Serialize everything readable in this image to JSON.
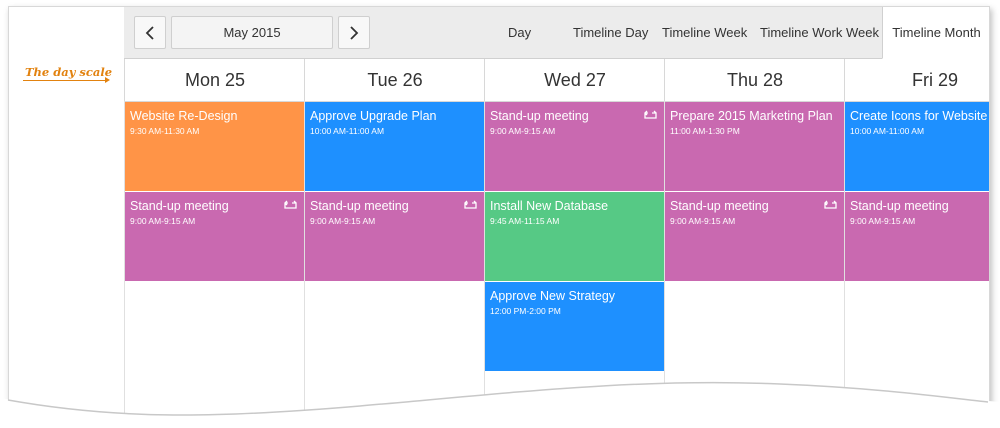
{
  "annotation": "The day scale",
  "toolbar": {
    "prev_icon": "chevron-left-icon",
    "next_icon": "chevron-right-icon",
    "date_label": "May 2015",
    "views": [
      {
        "label": "Day"
      },
      {
        "label": "Timeline Day"
      },
      {
        "label": "Timeline Week"
      },
      {
        "label": "Timeline Work Week"
      },
      {
        "label": "Timeline Month",
        "active": true
      }
    ]
  },
  "days": [
    {
      "label": "Mon 25"
    },
    {
      "label": "Tue 26"
    },
    {
      "label": "Wed 27"
    },
    {
      "label": "Thu 28"
    },
    {
      "label": "Fri 29"
    }
  ],
  "colors": {
    "orange": "#ff9447",
    "blue": "#1e90ff",
    "purple": "#c969b0",
    "green": "#56c985",
    "accent": "#e2820f"
  },
  "appointments": [
    {
      "day": 0,
      "row": 0,
      "subject": "Website Re-Design",
      "time": "9:30 AM-11:30 AM",
      "color": "orange",
      "recurring": false
    },
    {
      "day": 0,
      "row": 1,
      "subject": "Stand-up meeting",
      "time": "9:00 AM-9:15 AM",
      "color": "purple",
      "recurring": true
    },
    {
      "day": 1,
      "row": 0,
      "subject": "Approve Upgrade Plan",
      "time": "10:00 AM-11:00 AM",
      "color": "blue",
      "recurring": false
    },
    {
      "day": 1,
      "row": 1,
      "subject": "Stand-up meeting",
      "time": "9:00 AM-9:15 AM",
      "color": "purple",
      "recurring": true
    },
    {
      "day": 2,
      "row": 0,
      "subject": "Stand-up meeting",
      "time": "9:00 AM-9:15 AM",
      "color": "purple",
      "recurring": true
    },
    {
      "day": 2,
      "row": 1,
      "subject": "Install New Database",
      "time": "9:45 AM-11:15 AM",
      "color": "green",
      "recurring": false
    },
    {
      "day": 2,
      "row": 2,
      "subject": "Approve New Strategy",
      "time": "12:00 PM-2:00 PM",
      "color": "blue",
      "recurring": false
    },
    {
      "day": 3,
      "row": 0,
      "subject": "Prepare 2015 Marketing Plan",
      "time": "11:00 AM-1:30 PM",
      "color": "purple",
      "recurring": false
    },
    {
      "day": 3,
      "row": 1,
      "subject": "Stand-up meeting",
      "time": "9:00 AM-9:15 AM",
      "color": "purple",
      "recurring": true
    },
    {
      "day": 4,
      "row": 0,
      "subject": "Create Icons for Website",
      "time": "10:00 AM-11:00 AM",
      "color": "blue",
      "recurring": false
    },
    {
      "day": 4,
      "row": 1,
      "subject": "Stand-up meeting",
      "time": "9:00 AM-9:15 AM",
      "color": "purple",
      "recurring": true
    }
  ]
}
